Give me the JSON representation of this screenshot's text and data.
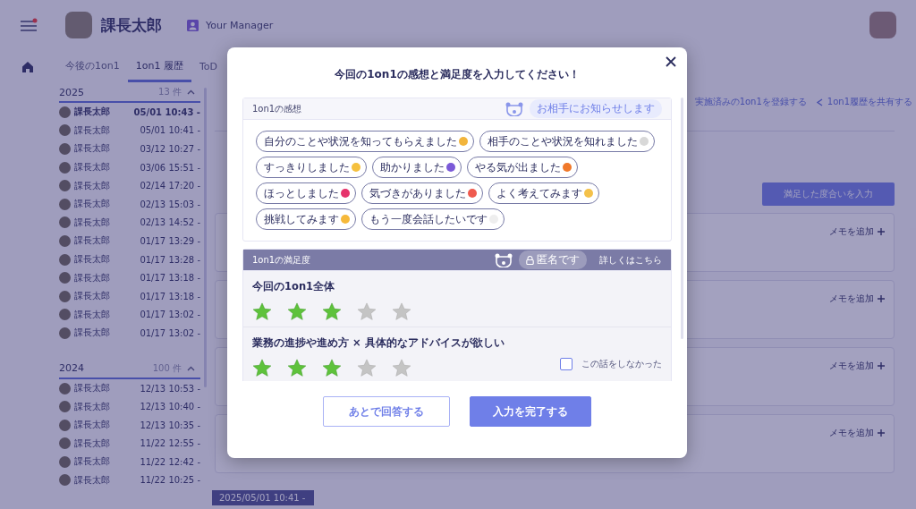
{
  "header": {
    "user_name": "課長太郎",
    "role": "Your Manager",
    "menu_alert": true
  },
  "tabs": [
    {
      "label": "今後の1on1",
      "selected": false
    },
    {
      "label": "1on1 履歴",
      "selected": true
    },
    {
      "label": "ToD",
      "selected": false
    }
  ],
  "history": [
    {
      "year": "2025",
      "count": "13 件",
      "expanded": true,
      "items": [
        {
          "name": "課長太郎",
          "time": "05/01 10:43 -",
          "selected": true
        },
        {
          "name": "課長太郎",
          "time": "05/01 10:41 -",
          "selected": false
        },
        {
          "name": "課長太郎",
          "time": "03/12 10:27 -",
          "selected": false
        },
        {
          "name": "課長太郎",
          "time": "03/06 15:51 -",
          "selected": false
        },
        {
          "name": "課長太郎",
          "time": "02/14 17:20 -",
          "selected": false
        },
        {
          "name": "課長太郎",
          "time": "02/13 15:03 -",
          "selected": false
        },
        {
          "name": "課長太郎",
          "time": "02/13 14:52 -",
          "selected": false
        },
        {
          "name": "課長太郎",
          "time": "01/17 13:29 -",
          "selected": false
        },
        {
          "name": "課長太郎",
          "time": "01/17 13:28 -",
          "selected": false
        },
        {
          "name": "課長太郎",
          "time": "01/17 13:18 -",
          "selected": false
        },
        {
          "name": "課長太郎",
          "time": "01/17 13:18 -",
          "selected": false
        },
        {
          "name": "課長太郎",
          "time": "01/17 13:02 -",
          "selected": false
        },
        {
          "name": "課長太郎",
          "time": "01/17 13:02 -",
          "selected": false
        }
      ]
    },
    {
      "year": "2024",
      "count": "100 件",
      "expanded": true,
      "items": [
        {
          "name": "課長太郎",
          "time": "12/13 10:53 -",
          "selected": false
        },
        {
          "name": "課長太郎",
          "time": "12/13 10:40 -",
          "selected": false
        },
        {
          "name": "課長太郎",
          "time": "12/13 10:35 -",
          "selected": false
        },
        {
          "name": "課長太郎",
          "time": "11/22 12:55 -",
          "selected": false
        },
        {
          "name": "課長太郎",
          "time": "11/22 12:42 -",
          "selected": false
        },
        {
          "name": "課長太郎",
          "time": "11/22 10:25 -",
          "selected": false
        }
      ]
    }
  ],
  "actions": [
    "実施済みの1on1を登録する",
    "1on1履歴を共有する"
  ],
  "satisfaction_button": "満足した度合いを入力",
  "memo_cards": [
    "メモを追加",
    "メモを追加",
    "メモを追加",
    "メモを追加"
  ],
  "bottom_label": "2025/05/01 10:41 -",
  "modal": {
    "title": "今回の1on1の感想と満足度を入力してください！",
    "impressions": {
      "title": "1on1の感想",
      "notice": "お相手にお知らせします",
      "chips": [
        {
          "label": "自分のことや状況を知ってもらえました",
          "color": "#f2b53c"
        },
        {
          "label": "相手のことや状況を知れました",
          "color": "#d8d8d8"
        },
        {
          "label": "すっきりしました",
          "color": "#f5c03e"
        },
        {
          "label": "助かりました",
          "color": "#7b5ad8"
        },
        {
          "label": "やる気が出ました",
          "color": "#f0782a"
        },
        {
          "label": "ほっとしました",
          "color": "#e6336b"
        },
        {
          "label": "気づきがありました",
          "color": "#ef5a4e"
        },
        {
          "label": "よく考えてみます",
          "color": "#f4c14a"
        },
        {
          "label": "挑戦してみます",
          "color": "#f6b93a"
        },
        {
          "label": "もう一度会話したいです",
          "color": "#eeeeee"
        }
      ]
    },
    "satisfaction": {
      "title": "1on1の満足度",
      "anonymous": "匿名です",
      "details_link": "詳しくはこちら",
      "questions": [
        {
          "kind": "overall",
          "label": "今回の1on1全体",
          "stars": 3
        },
        {
          "kind": "topic",
          "label": "業務の進捗や進め方 × 具体的なアドバイスが欲しい",
          "stars": 3,
          "skip_label": "この話をしなかった",
          "skipped": false
        }
      ]
    },
    "buttons": [
      {
        "kind": "secondary",
        "label": "あとで回答する"
      },
      {
        "kind": "primary",
        "label": "入力を完了する"
      }
    ]
  }
}
